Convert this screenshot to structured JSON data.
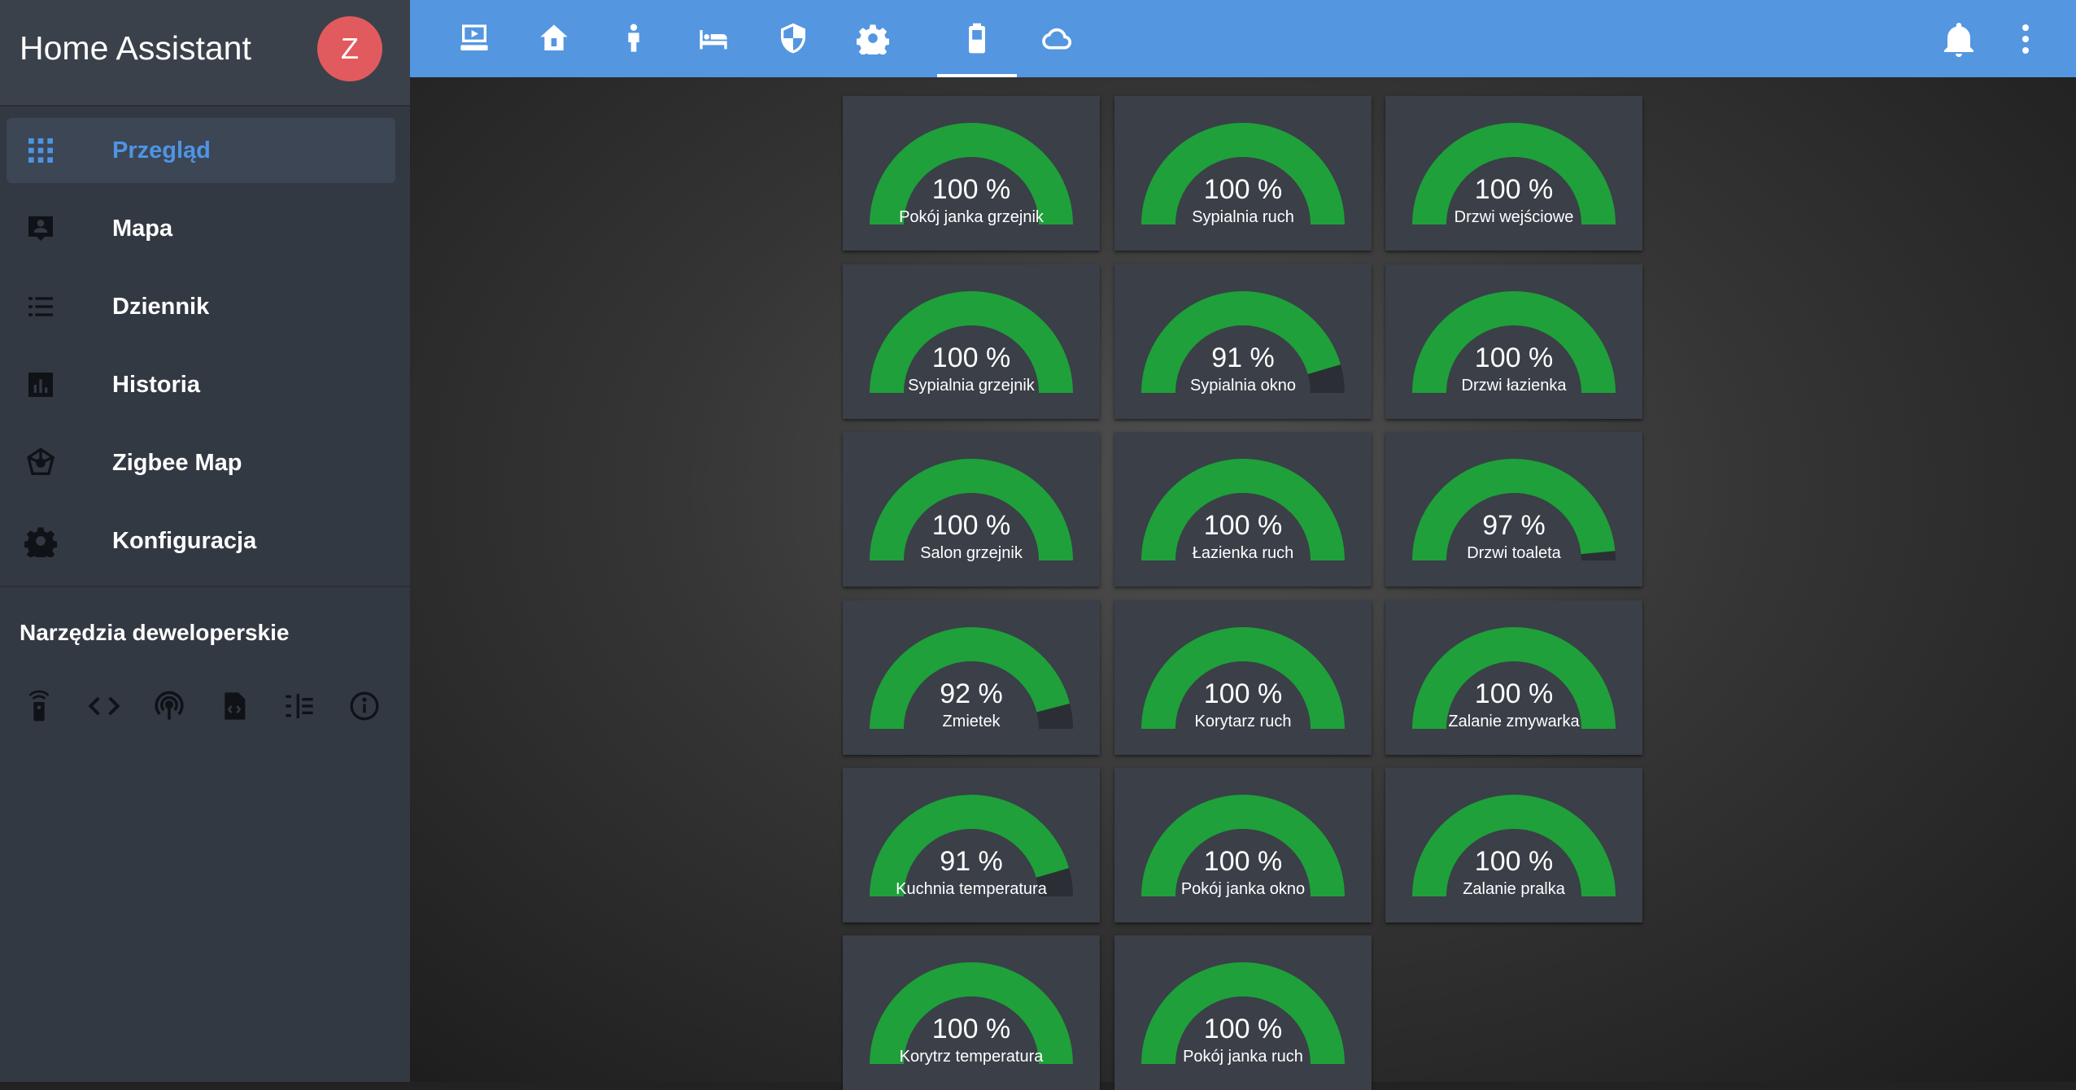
{
  "app": {
    "title": "Home Assistant",
    "avatar_initial": "Z"
  },
  "sidebar": {
    "items": [
      {
        "label": "Przegląd",
        "icon": "grid-icon",
        "active": true
      },
      {
        "label": "Mapa",
        "icon": "map-account-icon",
        "active": false
      },
      {
        "label": "Dziennik",
        "icon": "list-icon",
        "active": false
      },
      {
        "label": "Historia",
        "icon": "chart-bar-icon",
        "active": false
      },
      {
        "label": "Zigbee Map",
        "icon": "graph-outline-icon",
        "active": false
      },
      {
        "label": "Konfiguracja",
        "icon": "gear-icon",
        "active": false
      }
    ],
    "dev_tools_title": "Narzędzia deweloperskie",
    "dev_tools": [
      "remote-icon",
      "code-icon",
      "radio-tower-icon",
      "file-code-icon",
      "timeline-icon",
      "info-icon"
    ]
  },
  "tabs": [
    {
      "icon": "media-icon",
      "active": false
    },
    {
      "icon": "home-icon",
      "active": false
    },
    {
      "icon": "person-icon",
      "active": false
    },
    {
      "icon": "bed-icon",
      "active": false
    },
    {
      "icon": "shield-icon",
      "active": false
    },
    {
      "icon": "gear-icon",
      "active": false
    },
    {
      "icon": "battery-icon",
      "active": true
    },
    {
      "icon": "cloud-icon",
      "active": false
    }
  ],
  "header_actions": [
    "bell-icon",
    "more-vertical-icon"
  ],
  "colors": {
    "accent": "#5496e0",
    "gauge_fill": "#1fa03a",
    "gauge_bg": "#2b2f35",
    "card_bg": "#3a3f48",
    "avatar": "#e15b5e"
  },
  "gauges": [
    {
      "name": "Pokój janka grzejnik",
      "value": 100,
      "display": "100 %"
    },
    {
      "name": "Sypialnia ruch",
      "value": 100,
      "display": "100 %"
    },
    {
      "name": "Drzwi wejściowe",
      "value": 100,
      "display": "100 %"
    },
    {
      "name": "Sypialnia grzejnik",
      "value": 100,
      "display": "100 %"
    },
    {
      "name": "Sypialnia okno",
      "value": 91,
      "display": "91 %"
    },
    {
      "name": "Drzwi łazienka",
      "value": 100,
      "display": "100 %"
    },
    {
      "name": "Salon grzejnik",
      "value": 100,
      "display": "100 %"
    },
    {
      "name": "Łazienka ruch",
      "value": 100,
      "display": "100 %"
    },
    {
      "name": "Drzwi toaleta",
      "value": 97,
      "display": "97 %"
    },
    {
      "name": "Zmietek",
      "value": 92,
      "display": "92 %"
    },
    {
      "name": "Korytarz ruch",
      "value": 100,
      "display": "100 %"
    },
    {
      "name": "Zalanie zmywarka",
      "value": 100,
      "display": "100 %"
    },
    {
      "name": "Kuchnia temperatura",
      "value": 91,
      "display": "91 %"
    },
    {
      "name": "Pokój janka okno",
      "value": 100,
      "display": "100 %"
    },
    {
      "name": "Zalanie pralka",
      "value": 100,
      "display": "100 %"
    },
    {
      "name": "Korytrz temperatura",
      "value": 100,
      "display": "100 %"
    },
    {
      "name": "Pokój janka ruch",
      "value": 100,
      "display": "100 %"
    }
  ]
}
